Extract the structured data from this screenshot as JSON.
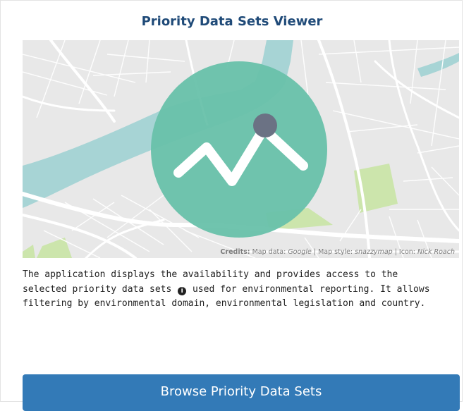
{
  "card": {
    "title": "Priority Data Sets Viewer"
  },
  "map": {
    "icon": "line-chart-icon",
    "credits": {
      "label": "Credits:",
      "map_data_label": "Map data:",
      "map_data_value": "Google",
      "map_style_label": "Map style:",
      "map_style_value": "snazzymap",
      "icon_label": "Icon:",
      "icon_value": "Nick Roach"
    },
    "colors": {
      "land": "#e8e8e8",
      "water": "#a7d4d5",
      "park": "#cce5ac",
      "circle": "#68c1aa",
      "chart_line": "#ffffff",
      "chart_dot": "#6b7284"
    }
  },
  "description": {
    "line1": "The application displays the availability and provides access to the",
    "line2_before": "selected priority data sets",
    "info_icon": "info-icon",
    "line2_after": "used for environmental reporting. It allows",
    "line3": "filtering by environmental domain, environmental legislation and country."
  },
  "actions": {
    "browse_label": "Browse Priority Data Sets",
    "button_color": "#337ab7"
  }
}
